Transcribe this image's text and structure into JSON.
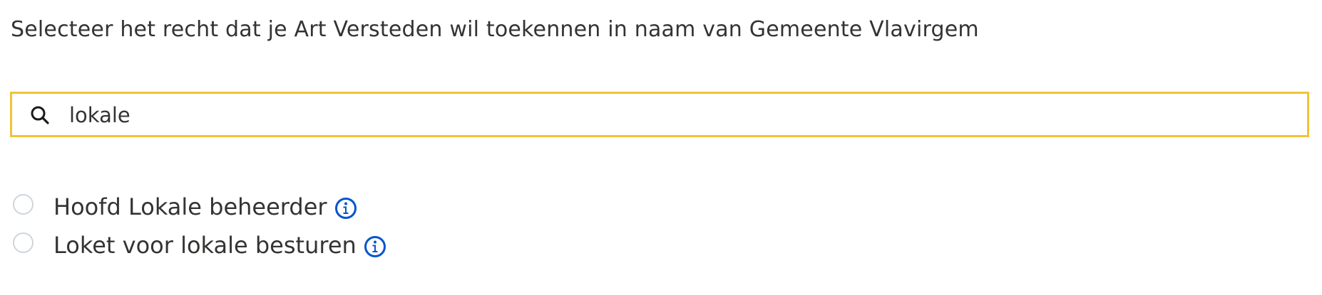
{
  "intro": {
    "text": "Selecteer het recht dat je  Art Versteden wil toekennen in naam van Gemeente Vlavirgem"
  },
  "search": {
    "value": "lokale",
    "icon": "search-icon",
    "border_color": "#f2c335"
  },
  "options": [
    {
      "label": "Hoofd Lokale beheerder",
      "selected": false,
      "icon": "info-icon"
    },
    {
      "label": "Loket voor lokale besturen",
      "selected": false,
      "icon": "info-icon"
    }
  ],
  "colors": {
    "text": "#333332",
    "accent": "#0055cc",
    "radio_border": "#cfd5dd"
  }
}
